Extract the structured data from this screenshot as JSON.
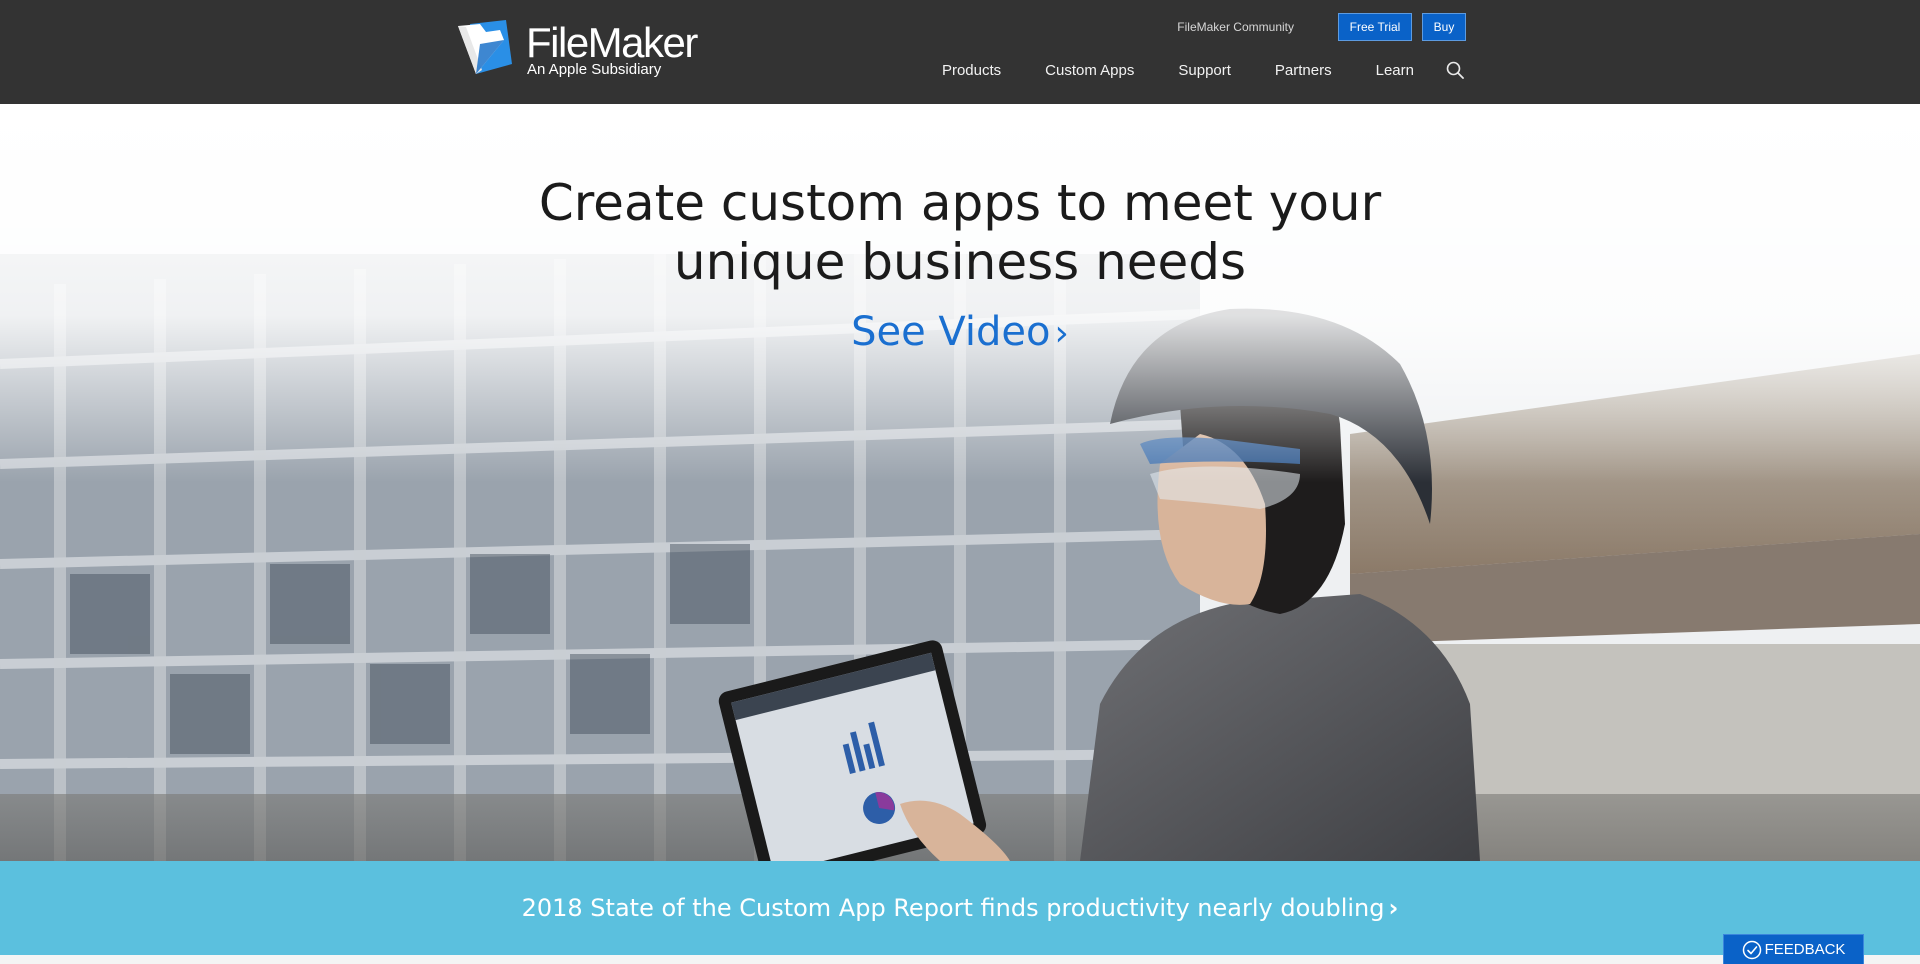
{
  "header": {
    "logo": {
      "wordmark": "FileMaker",
      "subtitle": "An Apple Subsidiary"
    },
    "top_links": {
      "community": "FileMaker Community",
      "free_trial": "Free Trial",
      "buy": "Buy"
    },
    "nav": {
      "items": [
        {
          "label": "Products"
        },
        {
          "label": "Custom Apps"
        },
        {
          "label": "Support"
        },
        {
          "label": "Partners"
        },
        {
          "label": "Learn"
        }
      ],
      "search_icon": "search-icon"
    }
  },
  "hero": {
    "title_line1": "Create custom apps to meet your",
    "title_line2": "unique business needs",
    "cta": "See Video",
    "cta_icon": "chevron-right-icon"
  },
  "banner": {
    "text": "2018 State of the Custom App Report finds productivity nearly doubling",
    "icon": "chevron-right-icon"
  },
  "feedback": {
    "label": "FEEDBACK",
    "icon": "check-circle-icon"
  },
  "colors": {
    "header_bg": "#333333",
    "accent_blue": "#0a62c8",
    "link_blue": "#1a6fd0",
    "banner_bg": "#5bc0de"
  }
}
